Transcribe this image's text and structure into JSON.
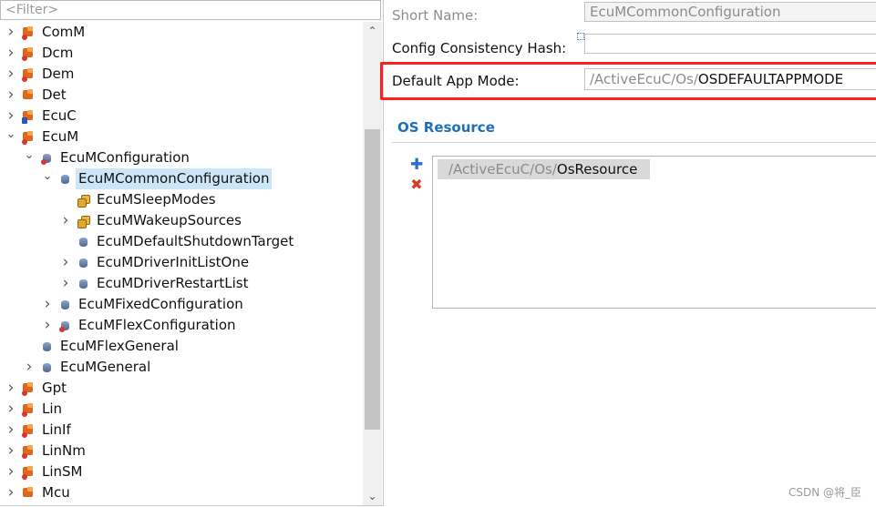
{
  "filter": {
    "placeholder": "<Filter>"
  },
  "tree": [
    {
      "label": "ComM",
      "depth": 0,
      "twisty": "collapsed",
      "icon": "module-error-icon"
    },
    {
      "label": "Dcm",
      "depth": 0,
      "twisty": "collapsed",
      "icon": "module-error-icon"
    },
    {
      "label": "Dem",
      "depth": 0,
      "twisty": "collapsed",
      "icon": "module-error-icon"
    },
    {
      "label": "Det",
      "depth": 0,
      "twisty": "collapsed",
      "icon": "module-icon"
    },
    {
      "label": "EcuC",
      "depth": 0,
      "twisty": "collapsed",
      "icon": "module-locked-icon"
    },
    {
      "label": "EcuM",
      "depth": 0,
      "twisty": "expanded",
      "icon": "module-error-icon"
    },
    {
      "label": "EcuMConfiguration",
      "depth": 1,
      "twisty": "expanded",
      "icon": "container-error-icon"
    },
    {
      "label": "EcuMCommonConfiguration",
      "depth": 2,
      "twisty": "expanded",
      "icon": "container-icon",
      "selected": true
    },
    {
      "label": "EcuMSleepModes",
      "depth": 3,
      "twisty": "none",
      "icon": "multi-container-icon"
    },
    {
      "label": "EcuMWakeupSources",
      "depth": 3,
      "twisty": "collapsed",
      "icon": "multi-container-icon"
    },
    {
      "label": "EcuMDefaultShutdownTarget",
      "depth": 3,
      "twisty": "none",
      "icon": "container-icon"
    },
    {
      "label": "EcuMDriverInitListOne",
      "depth": 3,
      "twisty": "collapsed",
      "icon": "container-icon"
    },
    {
      "label": "EcuMDriverRestartList",
      "depth": 3,
      "twisty": "collapsed",
      "icon": "container-icon"
    },
    {
      "label": "EcuMFixedConfiguration",
      "depth": 2,
      "twisty": "collapsed",
      "icon": "container-icon"
    },
    {
      "label": "EcuMFlexConfiguration",
      "depth": 2,
      "twisty": "collapsed",
      "icon": "container-error-icon"
    },
    {
      "label": "EcuMFlexGeneral",
      "depth": 1,
      "twisty": "none",
      "icon": "container-icon"
    },
    {
      "label": "EcuMGeneral",
      "depth": 1,
      "twisty": "collapsed",
      "icon": "container-icon"
    },
    {
      "label": "Gpt",
      "depth": 0,
      "twisty": "collapsed",
      "icon": "module-error-icon"
    },
    {
      "label": "Lin",
      "depth": 0,
      "twisty": "collapsed",
      "icon": "module-error-icon"
    },
    {
      "label": "LinIf",
      "depth": 0,
      "twisty": "collapsed",
      "icon": "module-error-icon"
    },
    {
      "label": "LinNm",
      "depth": 0,
      "twisty": "collapsed",
      "icon": "module-error-icon"
    },
    {
      "label": "LinSM",
      "depth": 0,
      "twisty": "collapsed",
      "icon": "module-error-icon"
    },
    {
      "label": "Mcu",
      "depth": 0,
      "twisty": "collapsed",
      "icon": "module-icon"
    }
  ],
  "scrollbar": {
    "up_icon": "chevron-up-icon",
    "down_icon": "chevron-down-icon"
  },
  "editor": {
    "short_name": {
      "label": "Short Name:",
      "value": "EcuMCommonConfiguration"
    },
    "hash": {
      "label": "Config Consistency Hash:",
      "value": ""
    },
    "default_app_mode": {
      "label": "Default App Mode:",
      "prefix": "/ActiveEcuC/Os/",
      "value": "OSDEFAULTAPPMODE"
    },
    "os_resource": {
      "title": "OS Resource",
      "items": [
        {
          "prefix": "/ActiveEcuC/Os/",
          "value": "OsResource"
        }
      ]
    }
  },
  "watermark": "CSDN @将_臣",
  "colors": {
    "accent": "#1f6fb7",
    "highlight": "#ff1f1f",
    "selection": "#cde6f7"
  }
}
